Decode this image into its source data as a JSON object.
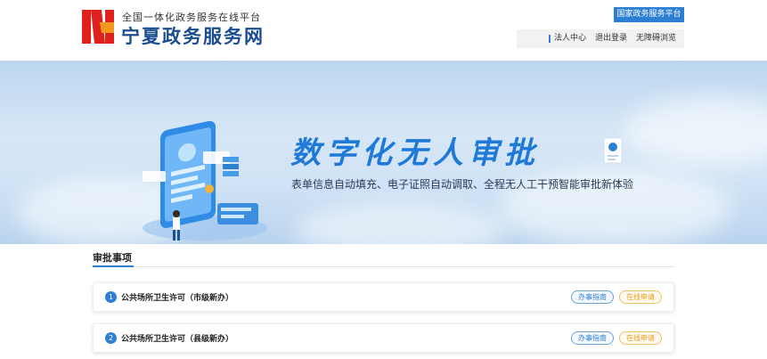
{
  "header": {
    "platform_subtitle": "全国一体化政务服务在线平台",
    "site_title": "宁夏政务服务网",
    "national_platform": "国家政务服务平台",
    "user_nav": {
      "legal_center": "法人中心",
      "logout": "退出登录",
      "accessible": "无障碍浏览"
    },
    "brand_colors": {
      "logo_red": "#e0201c",
      "logo_orange": "#f39a1e",
      "title_blue": "#1a4d8f"
    }
  },
  "banner": {
    "title": "数字化无人审批",
    "description": "表单信息自动填充、电子证照自动调取、全程无人工干预智能审批新体验",
    "accent": "#1e79d8"
  },
  "approval": {
    "section_title": "审批事项",
    "items": [
      {
        "index": "1",
        "name": "公共场所卫生许可（市级新办）",
        "guide": "办事指南",
        "apply": "在线申请"
      },
      {
        "index": "2",
        "name": "公共场所卫生许可（县级新办）",
        "guide": "办事指南",
        "apply": "在线申请"
      }
    ]
  }
}
